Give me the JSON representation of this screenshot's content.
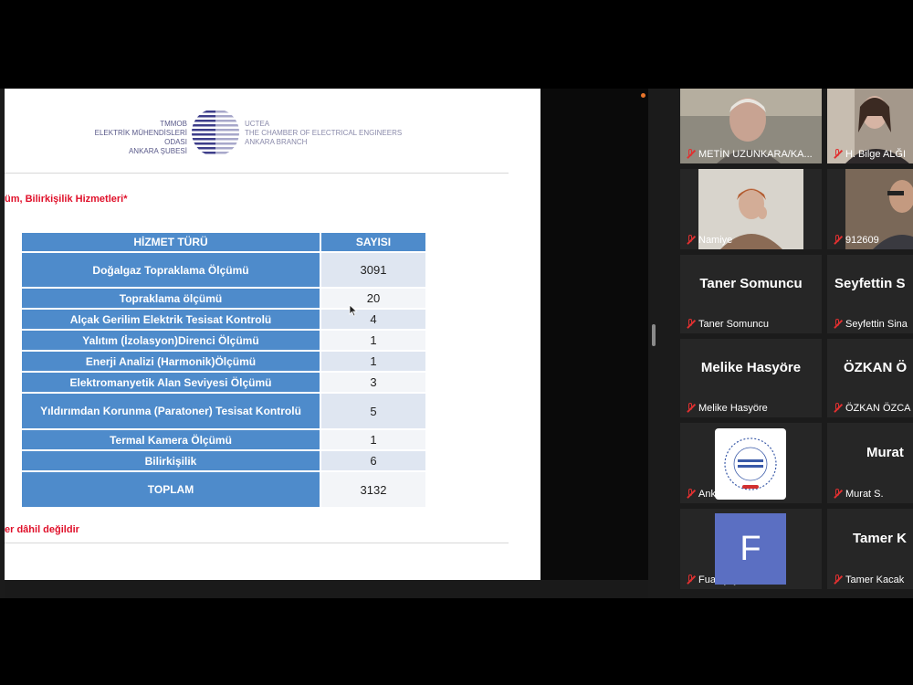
{
  "slide": {
    "logo_left_lines": [
      "TMMOB",
      "ELEKTRİK MÜHENDİSLERİ ODASI",
      "ANKARA ŞUBESİ"
    ],
    "logo_right_lines": [
      "UCTEA",
      "THE CHAMBER OF ELECTRICAL ENGINEERS",
      "ANKARA BRANCH"
    ],
    "subtitle": "üm, Bilirkişilik Hizmetleri*",
    "footnote": "er dâhil değildir",
    "table": {
      "header": [
        "HİZMET TÜRÜ",
        "SAYISI"
      ],
      "rows": [
        {
          "label": "Doğalgaz Topraklama Ölçümü",
          "value": "3091"
        },
        {
          "label": "Topraklama ölçümü",
          "value": "20"
        },
        {
          "label": "Alçak Gerilim Elektrik Tesisat Kontrolü",
          "value": "4"
        },
        {
          "label": "Yalıtım (İzolasyon)Direnci Ölçümü",
          "value": "1"
        },
        {
          "label": "Enerji Analizi (Harmonik)Ölçümü",
          "value": "1"
        },
        {
          "label": "Elektromanyetik Alan Seviyesi Ölçümü",
          "value": "3"
        },
        {
          "label": "Yıldırımdan Korunma (Paratoner) Tesisat Kontrolü",
          "value": "5"
        },
        {
          "label": "Termal Kamera Ölçümü",
          "value": "1"
        },
        {
          "label": "Bilirkişilik",
          "value": "6"
        },
        {
          "label": "TOPLAM",
          "value": "3132"
        }
      ]
    }
  },
  "participants": [
    {
      "label": "METİN UZUNKARA/KA...",
      "big": ""
    },
    {
      "label": "H. Bilge ALĞI",
      "big": ""
    },
    {
      "label": "Namiye",
      "big": ""
    },
    {
      "label": "912609",
      "big": ""
    },
    {
      "label": "Taner Somuncu",
      "big": "Taner Somuncu"
    },
    {
      "label": "Seyfettin Sina",
      "big": "Seyfettin S"
    },
    {
      "label": "Melike Hasyöre",
      "big": "Melike Hasyöre"
    },
    {
      "label": "ÖZKAN ÖZCA",
      "big": "ÖZKAN Ö"
    },
    {
      "label": "Ankara EMO",
      "big": ""
    },
    {
      "label": "Murat S.",
      "big": "Murat"
    },
    {
      "label": "Fuat Şaylan",
      "big": "",
      "avatar_letter": "F"
    },
    {
      "label": "Tamer Kacak",
      "big": "Tamer K"
    }
  ],
  "colors": {
    "table_blue": "#4e8bcb",
    "accent_red": "#e0102a",
    "avatar_purple": "#5b6fc2"
  }
}
